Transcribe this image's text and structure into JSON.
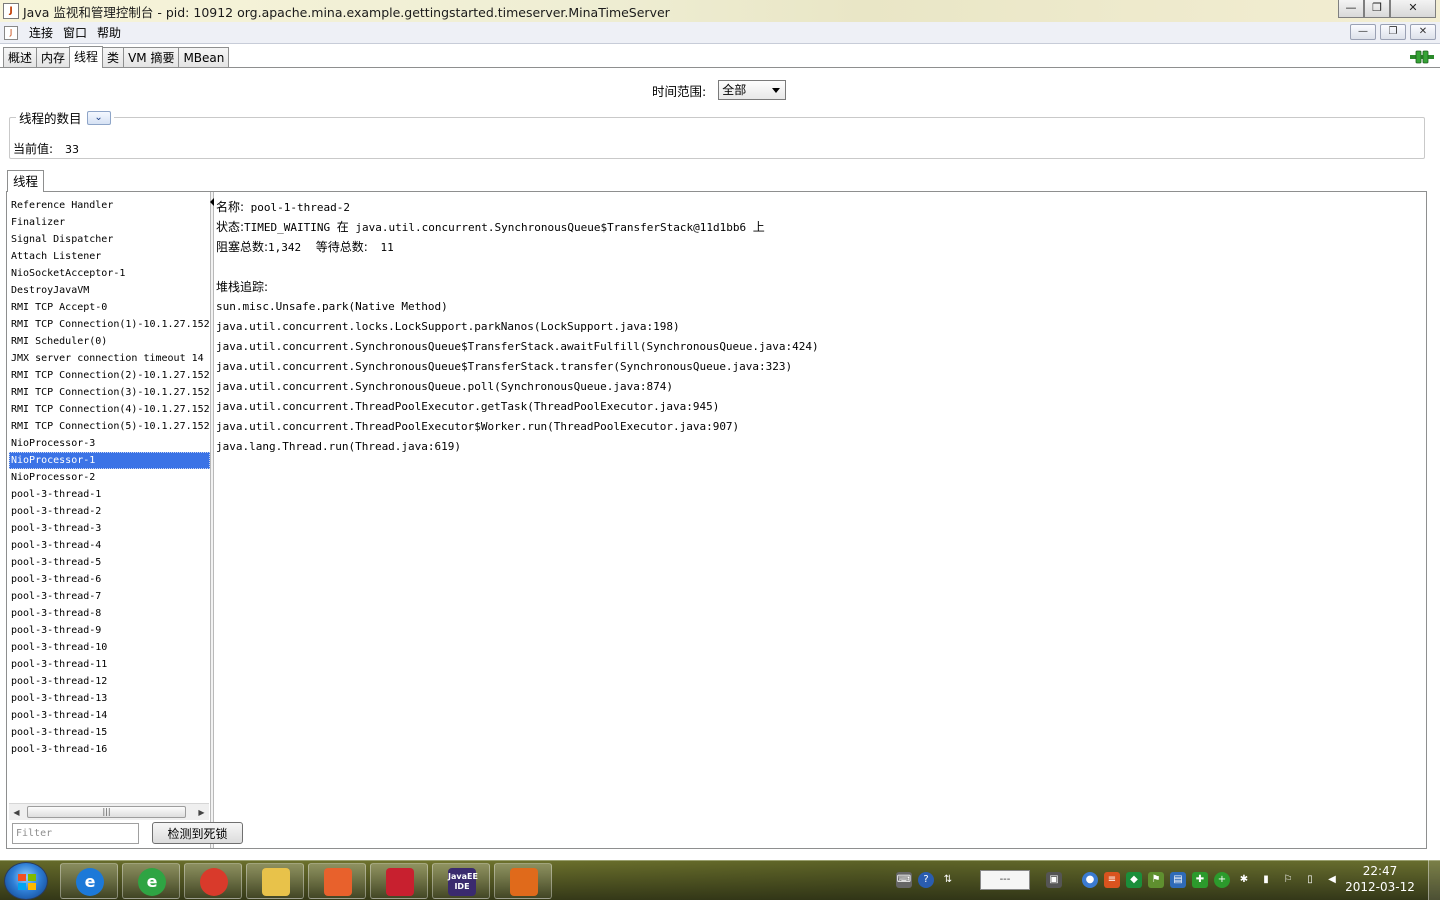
{
  "window": {
    "title": "Java 监视和管理控制台 - pid: 10912 org.apache.mina.example.gettingstarted.timeserver.MinaTimeServer",
    "minimize": "—",
    "maximize": "❐",
    "close": "✕"
  },
  "menu": {
    "items": [
      "连接",
      "窗口",
      "帮助"
    ]
  },
  "tabs": [
    {
      "label": "概述"
    },
    {
      "label": "内存"
    },
    {
      "label": "线程",
      "active": true
    },
    {
      "label": "类"
    },
    {
      "label": "VM 摘要"
    },
    {
      "label": "MBean"
    }
  ],
  "time_range": {
    "label": "时间范围:",
    "selected": "全部"
  },
  "thread_count": {
    "legend": "线程的数目",
    "current_label": "当前值:",
    "current_value": "33"
  },
  "threads_panel": {
    "tab_label": "线程",
    "threads": [
      "Reference Handler",
      "Finalizer",
      "Signal Dispatcher",
      "Attach Listener",
      "NioSocketAcceptor-1",
      "DestroyJavaVM",
      "RMI TCP Accept-0",
      "RMI TCP Connection(1)-10.1.27.152",
      "RMI Scheduler(0)",
      "JMX server connection timeout 14",
      "RMI TCP Connection(2)-10.1.27.152",
      "RMI TCP Connection(3)-10.1.27.152",
      "RMI TCP Connection(4)-10.1.27.152",
      "RMI TCP Connection(5)-10.1.27.152",
      "NioProcessor-3",
      "NioProcessor-1",
      "NioProcessor-2",
      "pool-3-thread-1",
      "pool-3-thread-2",
      "pool-3-thread-3",
      "pool-3-thread-4",
      "pool-3-thread-5",
      "pool-3-thread-6",
      "pool-3-thread-7",
      "pool-3-thread-8",
      "pool-3-thread-9",
      "pool-3-thread-10",
      "pool-3-thread-11",
      "pool-3-thread-12",
      "pool-3-thread-13",
      "pool-3-thread-14",
      "pool-3-thread-15",
      "pool-3-thread-16"
    ],
    "selected_index": 15,
    "filter_placeholder": "Filter",
    "deadlock_button": "检测到死锁",
    "scroll_grip": "|||"
  },
  "details": {
    "name_label": "名称:",
    "name_value": "pool-1-thread-2",
    "state_label": "状态:",
    "state_value": "TIMED_WAITING",
    "state_on": "在",
    "state_object": "java.util.concurrent.SynchronousQueue$TransferStack@11d1bb6",
    "state_suffix": "上",
    "blocked_label": "阻塞总数:",
    "blocked_value": "1,342",
    "waited_label": "等待总数:",
    "waited_value": "11",
    "stack_label": "堆栈追踪:",
    "stack": [
      "sun.misc.Unsafe.park(Native Method)",
      "java.util.concurrent.locks.LockSupport.parkNanos(LockSupport.java:198)",
      "java.util.concurrent.SynchronousQueue$TransferStack.awaitFulfill(SynchronousQueue.java:424)",
      "java.util.concurrent.SynchronousQueue$TransferStack.transfer(SynchronousQueue.java:323)",
      "java.util.concurrent.SynchronousQueue.poll(SynchronousQueue.java:874)",
      "java.util.concurrent.ThreadPoolExecutor.getTask(ThreadPoolExecutor.java:945)",
      "java.util.concurrent.ThreadPoolExecutor$Worker.run(ThreadPoolExecutor.java:907)",
      "java.lang.Thread.run(Thread.java:619)"
    ]
  },
  "taskbar": {
    "apps": [
      {
        "name": "internet-explorer",
        "glyph": "e",
        "color": "#1c79d8"
      },
      {
        "name": "browser-green",
        "glyph": "e",
        "color": "#2fa443"
      },
      {
        "name": "chrome",
        "glyph": "",
        "color": "#d93a2b"
      },
      {
        "name": "file-explorer",
        "glyph": "",
        "color": "#e8c24a"
      },
      {
        "name": "sublime",
        "glyph": "",
        "color": "#e8612c"
      },
      {
        "name": "notepad",
        "glyph": "",
        "color": "#c8202f"
      },
      {
        "name": "java-ee-ide",
        "glyph": "JavaEE IDE",
        "color": "#3a2a6e"
      },
      {
        "name": "java-console",
        "glyph": "",
        "color": "#e06a1b"
      }
    ],
    "tray_input": "---",
    "time": "22:47",
    "date": "2012-03-12"
  },
  "colors": {
    "selection": "#3b73e6",
    "title_bar": "#efeed4",
    "taskbar": "#6e6d2a"
  }
}
